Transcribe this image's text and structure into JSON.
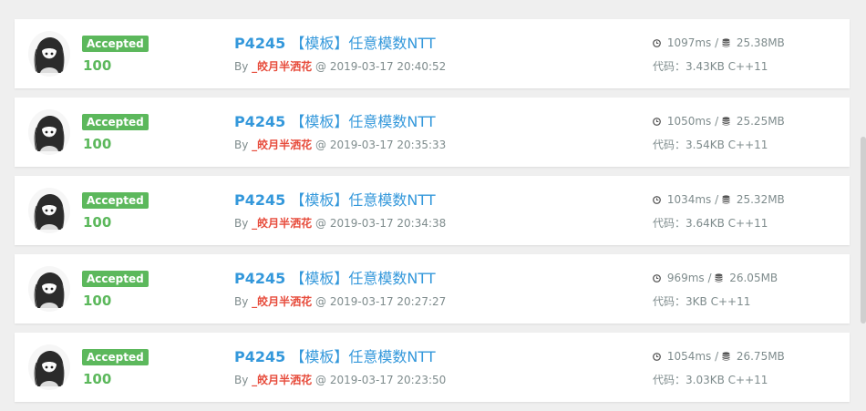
{
  "submissions": [
    {
      "status": "Accepted",
      "score": "100",
      "problem_id": "P4245",
      "problem_title": "【模板】任意模数NTT",
      "by": "By",
      "user": "_皎月半洒花",
      "at": "@",
      "time": "2019-03-17 20:40:52",
      "runtime": "1097ms",
      "sep": "/",
      "memory": "25.38MB",
      "code_label": "代码：",
      "code_size": "3.43KB",
      "language": "C++11"
    },
    {
      "status": "Accepted",
      "score": "100",
      "problem_id": "P4245",
      "problem_title": "【模板】任意模数NTT",
      "by": "By",
      "user": "_皎月半洒花",
      "at": "@",
      "time": "2019-03-17 20:35:33",
      "runtime": "1050ms",
      "sep": "/",
      "memory": "25.25MB",
      "code_label": "代码：",
      "code_size": "3.54KB",
      "language": "C++11"
    },
    {
      "status": "Accepted",
      "score": "100",
      "problem_id": "P4245",
      "problem_title": "【模板】任意模数NTT",
      "by": "By",
      "user": "_皎月半洒花",
      "at": "@",
      "time": "2019-03-17 20:34:38",
      "runtime": "1034ms",
      "sep": "/",
      "memory": "25.32MB",
      "code_label": "代码：",
      "code_size": "3.64KB",
      "language": "C++11"
    },
    {
      "status": "Accepted",
      "score": "100",
      "problem_id": "P4245",
      "problem_title": "【模板】任意模数NTT",
      "by": "By",
      "user": "_皎月半洒花",
      "at": "@",
      "time": "2019-03-17 20:27:27",
      "runtime": "969ms",
      "sep": "/",
      "memory": "26.05MB",
      "code_label": "代码：",
      "code_size": "3KB",
      "language": "C++11"
    },
    {
      "status": "Accepted",
      "score": "100",
      "problem_id": "P4245",
      "problem_title": "【模板】任意模数NTT",
      "by": "By",
      "user": "_皎月半洒花",
      "at": "@",
      "time": "2019-03-17 20:23:50",
      "runtime": "1054ms",
      "sep": "/",
      "memory": "26.75MB",
      "code_label": "代码：",
      "code_size": "3.03KB",
      "language": "C++11"
    }
  ],
  "icons": {
    "avatar": "anime-girl-avatar",
    "runtime": "clock-icon",
    "memory": "database-icon"
  },
  "colors": {
    "accepted": "#5cb85c",
    "link": "#3498db",
    "username": "#e74c3c",
    "meta_text": "#7f8c8d",
    "page_bg": "#efefef"
  }
}
